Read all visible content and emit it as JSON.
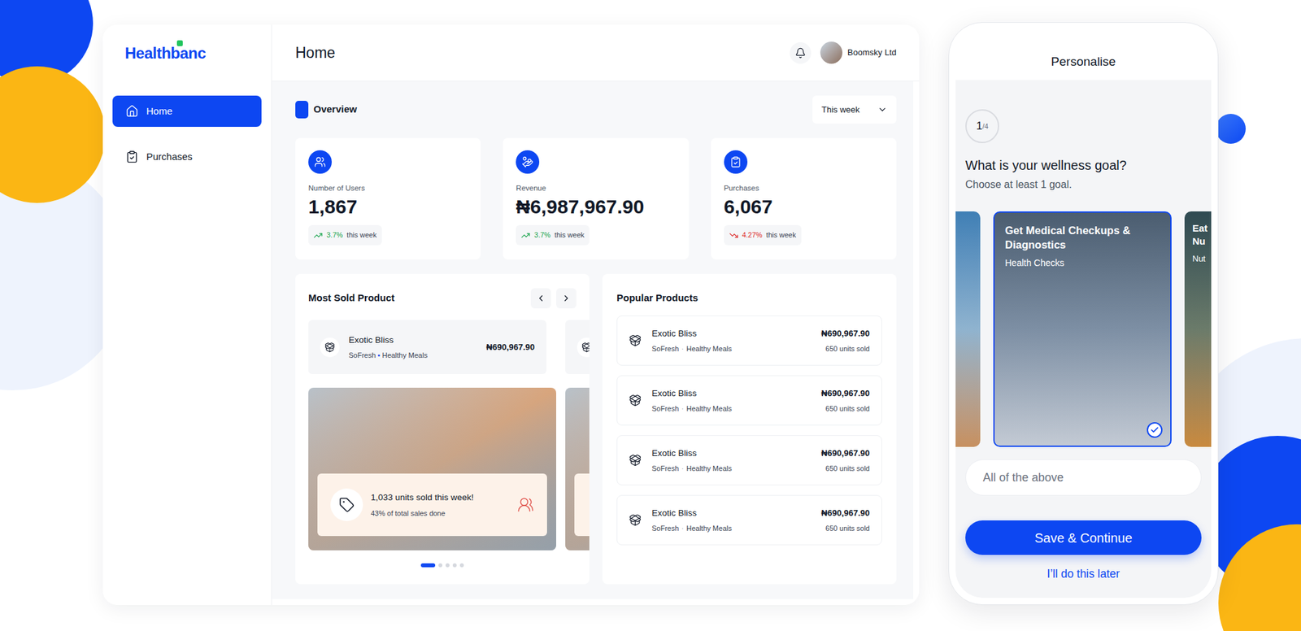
{
  "app": {
    "logo": "Healthbanc"
  },
  "sidebar": {
    "items": [
      {
        "label": "Home",
        "selected": true
      },
      {
        "label": "Purchases",
        "selected": false
      }
    ]
  },
  "header": {
    "title": "Home",
    "user": {
      "name": "Boomsky Ltd"
    }
  },
  "overview": {
    "title": "Overview",
    "period": "This week"
  },
  "stats": [
    {
      "label": "Number of Users",
      "value": "1,867",
      "change": "3.7%",
      "trend": "up",
      "period": "this week",
      "color": "#16a34a"
    },
    {
      "label": "Revenue",
      "value": "₦6,987,967.90",
      "change": "3.7%",
      "trend": "up",
      "period": "this week",
      "color": "#16a34a"
    },
    {
      "label": "Purchases",
      "value": "6,067",
      "change": "4.27%",
      "trend": "down",
      "period": "this week",
      "color": "#dc2626"
    }
  ],
  "most_sold": {
    "title": "Most Sold Product",
    "products": [
      {
        "kind": "full",
        "name": "Exotic Bliss",
        "brand": "SoFresh",
        "separator": "•",
        "category": "Healthy Meals",
        "price": "₦690,967.90"
      },
      {
        "kind": "partial"
      }
    ],
    "slides": [
      {
        "kind": "full",
        "headline": "1,033 units sold this week!",
        "detail": "43% of total sales done"
      },
      {
        "kind": "partial"
      }
    ],
    "pages": [
      {
        "selected": true
      },
      {
        "selected": false
      },
      {
        "selected": false
      },
      {
        "selected": false
      },
      {
        "selected": false
      }
    ]
  },
  "popular": {
    "title": "Popular Products",
    "items": [
      {
        "name": "Exotic Bliss",
        "brand": "SoFresh",
        "separator": "·",
        "category": "Healthy Meals",
        "price": "₦690,967.90",
        "sold": "650 units sold"
      },
      {
        "name": "Exotic Bliss",
        "brand": "SoFresh",
        "separator": "·",
        "category": "Healthy Meals",
        "price": "₦690,967.90",
        "sold": "650 units sold"
      },
      {
        "name": "Exotic Bliss",
        "brand": "SoFresh",
        "separator": "·",
        "category": "Healthy Meals",
        "price": "₦690,967.90",
        "sold": "650 units sold"
      },
      {
        "name": "Exotic Bliss",
        "brand": "SoFresh",
        "separator": "·",
        "category": "Healthy Meals",
        "price": "₦690,967.90",
        "sold": "650 units sold"
      }
    ]
  },
  "personalise": {
    "title": "Personalise",
    "step": {
      "current": "1",
      "total": "/4"
    },
    "question": "What is your wellness goal?",
    "hint": "Choose at least 1 goal.",
    "goals": [
      {
        "kind": "partial",
        "selected": false
      },
      {
        "kind": "full",
        "title": "Get Medical Checkups & Diagnostics",
        "subtitle": "Health Checks",
        "selected": true
      },
      {
        "kind": "partial",
        "title": "Eat Nu",
        "subtitle": "Nut",
        "selected": false
      }
    ],
    "all_option": {
      "label": "All of the above",
      "selected": false
    },
    "primary_button": "Save & Continue",
    "secondary_link": "I’ll do this later"
  }
}
